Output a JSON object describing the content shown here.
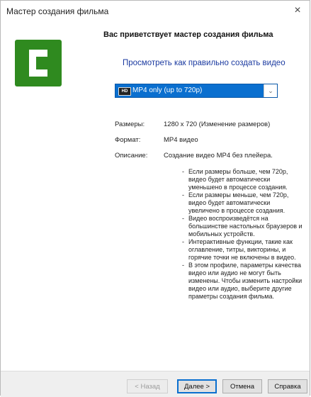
{
  "window": {
    "title": "Мастер создания фильма",
    "close_glyph": "×"
  },
  "logo": {
    "icon": "camtasia-logo",
    "color": "#2f8a1f"
  },
  "header": {
    "welcome": "Вас приветствует мастер создания фильма",
    "howto_link": "Просмотреть как правильно создать видео"
  },
  "preset_select": {
    "icon_text": "HD",
    "selected": "MP4 only (up to 720p)",
    "accent": "#0a6fcf"
  },
  "details": {
    "size_label": "Размеры:",
    "size_value": "1280 x 720 (Изменение размеров)",
    "format_label": "Формат:",
    "format_value": "MP4 видео",
    "description_label": "Описание:",
    "description_value": "Создание видео MP4 без плейера."
  },
  "bullets": [
    "Если размеры больше, чем 720p, видео будет автоматически уменьшено в процессе создания.",
    "Если размеры меньше, чем 720p, видео будет автоматически увеличено в процессе создания.",
    "Видео воспроизведётся на большинстве настольных браузеров и мобильных устройств.",
    "Интерактивные функции, такие как оглавление, титры, викторины, и горячие точки не включены в видео.",
    "В этом профиле, параметры качества видео или аудио не могут быть изменены. Чтобы изменить настройки видео или аудио, выберите другие праметры создания фильма."
  ],
  "buttons": {
    "back": "< Назад",
    "next": "Далее >",
    "cancel": "Отмена",
    "help": "Справка"
  }
}
